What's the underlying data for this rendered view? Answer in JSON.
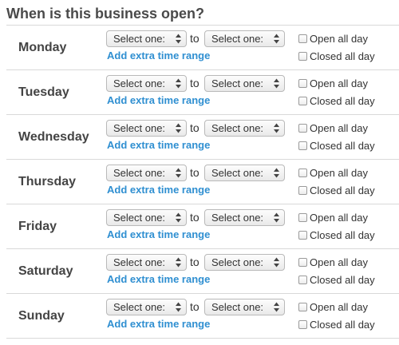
{
  "header": {
    "title": "When is this business open?"
  },
  "controls": {
    "select_placeholder": "Select one:",
    "to_label": "to",
    "add_range_label": "Add extra time range",
    "open_all_day_label": "Open all day",
    "closed_all_day_label": "Closed all day"
  },
  "days": [
    {
      "name": "Monday",
      "open_all_day": false,
      "closed_all_day": false
    },
    {
      "name": "Tuesday",
      "open_all_day": false,
      "closed_all_day": false
    },
    {
      "name": "Wednesday",
      "open_all_day": false,
      "closed_all_day": false
    },
    {
      "name": "Thursday",
      "open_all_day": false,
      "closed_all_day": false
    },
    {
      "name": "Friday",
      "open_all_day": false,
      "closed_all_day": false
    },
    {
      "name": "Saturday",
      "open_all_day": false,
      "closed_all_day": false
    },
    {
      "name": "Sunday",
      "open_all_day": false,
      "closed_all_day": false
    }
  ],
  "colors": {
    "link": "#2f8fd1",
    "text": "#444444",
    "divider": "#d9d9d9"
  }
}
